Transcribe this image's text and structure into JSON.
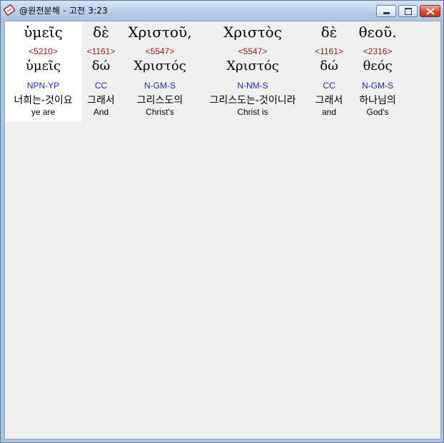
{
  "window": {
    "title": "@원전분해 - 고전 3:23"
  },
  "columns": [
    {
      "greek": "ὑμεῖς",
      "strong": "<5210>",
      "lemma": "ὑμεῖς",
      "parse": "NPN-YP",
      "korean": "너희는-것이요",
      "english": "ye are"
    },
    {
      "greek": "δὲ",
      "strong": "<1161>",
      "lemma": "δώ",
      "parse": "CC",
      "korean": "그래서",
      "english": "And"
    },
    {
      "greek": "Χριστοῦ,",
      "strong": "<5547>",
      "lemma": "Χριστός",
      "parse": "N-GM-S",
      "korean": "그리스도의",
      "english": "Christ's"
    },
    {
      "greek": "Χριστὸς",
      "strong": "<5547>",
      "lemma": "Χριστός",
      "parse": "N-NM-S",
      "korean": "그리스도는-것이니라",
      "english": "Christ is"
    },
    {
      "greek": "δὲ",
      "strong": "<1161>",
      "lemma": "δώ",
      "parse": "CC",
      "korean": "그래서",
      "english": "and"
    },
    {
      "greek": "θεοῦ.",
      "strong": "<2316>",
      "lemma": "θεός",
      "parse": "N-GM-S",
      "korean": "하나님의",
      "english": "God's"
    }
  ]
}
